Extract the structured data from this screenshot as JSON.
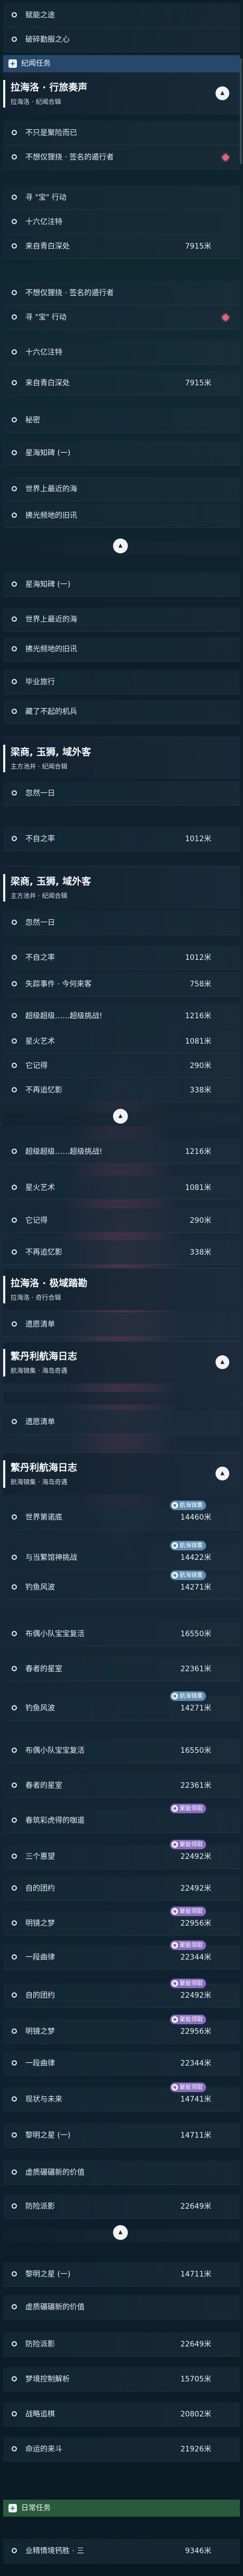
{
  "sections": {
    "archon": {
      "title": "纪闻任务"
    },
    "daily": {
      "title": "日常任务"
    }
  },
  "headers": [
    {
      "title": "拉海洛 · 行旅奏声",
      "sub": "拉海洛 · 纪闻合辑"
    },
    {
      "title": "梁商, 玉狮, 域外客",
      "sub": "主方池井 · 纪闻合辑"
    },
    {
      "title": "梁商, 玉狮, 域外客",
      "sub": "主方池井 · 纪闻合辑"
    },
    {
      "title": "拉海洛 · 极域踏勘",
      "sub": "拉海洛 · 奇行合辑"
    },
    {
      "title": "繁丹利航海日志",
      "sub": "航海锦集 · 海岛奇遇"
    },
    {
      "title": "繁丹利航海日志",
      "sub": "航海锦集 · 海岛奇遇"
    }
  ],
  "items": [
    {
      "label": "赋能之途",
      "dist": ""
    },
    {
      "label": "破碎勤服之心",
      "dist": ""
    },
    {
      "label": "不只是聚险而已",
      "dist": ""
    },
    {
      "label": "不想仅狸挠 · 签名的遁行者",
      "dist": ""
    },
    {
      "label": "寻 \"宝\" 行动",
      "dist": ""
    },
    {
      "label": "十六亿注特",
      "dist": ""
    },
    {
      "label": "来自青白深处",
      "dist": "7915米"
    },
    {
      "label": "不想仅狸挠 · 签名的遁行者",
      "dist": ""
    },
    {
      "label": "寻 \"宝\" 行动",
      "dist": ""
    },
    {
      "label": "十六亿注特",
      "dist": ""
    },
    {
      "label": "来自青白深处",
      "dist": "7915米"
    },
    {
      "label": "秘密",
      "dist": ""
    },
    {
      "label": "星海知碑 (一)",
      "dist": ""
    },
    {
      "label": "世界上最近的海",
      "dist": ""
    },
    {
      "label": "拂光频地的旧讯",
      "dist": ""
    },
    {
      "label": "星海知碑 (一)",
      "dist": ""
    },
    {
      "label": "世界上最近的海",
      "dist": ""
    },
    {
      "label": "拂光频地的旧讯",
      "dist": ""
    },
    {
      "label": "毕业旅行",
      "dist": ""
    },
    {
      "label": "藏了不起的机兵",
      "dist": ""
    },
    {
      "label": "忽然一日",
      "dist": ""
    },
    {
      "label": "不自之率",
      "dist": "1012米"
    },
    {
      "label": "忽然一日",
      "dist": ""
    },
    {
      "label": "不自之率",
      "dist": "1012米"
    },
    {
      "label": "失踪事件 · 今何来客",
      "dist": "758米"
    },
    {
      "label": "超级超级……超级挑战!",
      "dist": "1216米"
    },
    {
      "label": "星火艺术",
      "dist": "1081米"
    },
    {
      "label": "它记得",
      "dist": "290米"
    },
    {
      "label": "不再追忆影",
      "dist": "338米"
    },
    {
      "label": "超级超级……超级挑战!",
      "dist": "1216米"
    },
    {
      "label": "星火艺术",
      "dist": "1081米"
    },
    {
      "label": "它记得",
      "dist": "290米"
    },
    {
      "label": "不再追忆影",
      "dist": "338米"
    },
    {
      "label": "遗愿清单",
      "dist": ""
    },
    {
      "label": "遗愿清单",
      "dist": ""
    },
    {
      "label": "世界第诺底",
      "dist": "14460米"
    },
    {
      "label": "与当繁馆神挑战",
      "dist": "14422米"
    },
    {
      "label": "钓鱼风波",
      "dist": "14271米"
    },
    {
      "label": "布偶小队宝宝复活",
      "dist": "16550米"
    },
    {
      "label": "春者的星室",
      "dist": "22361米"
    },
    {
      "label": "钓鱼风波",
      "dist": "14271米"
    },
    {
      "label": "布偶小队宝宝复活",
      "dist": "16550米"
    },
    {
      "label": "春者的星室",
      "dist": "22361米"
    },
    {
      "label": "春筑彩虎得的咖道",
      "dist": ""
    },
    {
      "label": "三个惠望",
      "dist": "22492米"
    },
    {
      "label": "自的团约",
      "dist": "22492米"
    },
    {
      "label": "明镜之梦",
      "dist": "22956米"
    },
    {
      "label": "一段曲律",
      "dist": "22344米"
    },
    {
      "label": "自的团约",
      "dist": "22492米"
    },
    {
      "label": "明镜之梦",
      "dist": "22956米"
    },
    {
      "label": "一段曲律",
      "dist": "22344米"
    },
    {
      "label": "现状与未来",
      "dist": "14741米"
    },
    {
      "label": "黎明之星 (一)",
      "dist": "14711米"
    },
    {
      "label": "虚质碾碾新的价值",
      "dist": ""
    },
    {
      "label": "防险派影",
      "dist": "22649米"
    },
    {
      "label": "黎明之星 (一)",
      "dist": "14711米"
    },
    {
      "label": "虚质碾碾新的价值",
      "dist": ""
    },
    {
      "label": "防险派影",
      "dist": "22649米"
    },
    {
      "label": "梦境控制解析",
      "dist": "15705米"
    },
    {
      "label": "战略追棋",
      "dist": "20802米"
    },
    {
      "label": "命运的来斗",
      "dist": "21926米"
    },
    {
      "label": "业精情境钙胜 · 三",
      "dist": "9346米"
    }
  ],
  "markers": {
    "blue": "航海锦集",
    "purple": "聚能领取"
  },
  "colors": {
    "gem": "#e8607c",
    "section_archon": "#27486c",
    "section_daily": "#2a5a3c",
    "mark_blue": "#5f8db0",
    "mark_purple": "#8a6cc2"
  },
  "icons": {
    "radio": "ring-icon",
    "gem": "diamond-icon",
    "chevron": "chevron-icon",
    "section": "plus-icon"
  }
}
